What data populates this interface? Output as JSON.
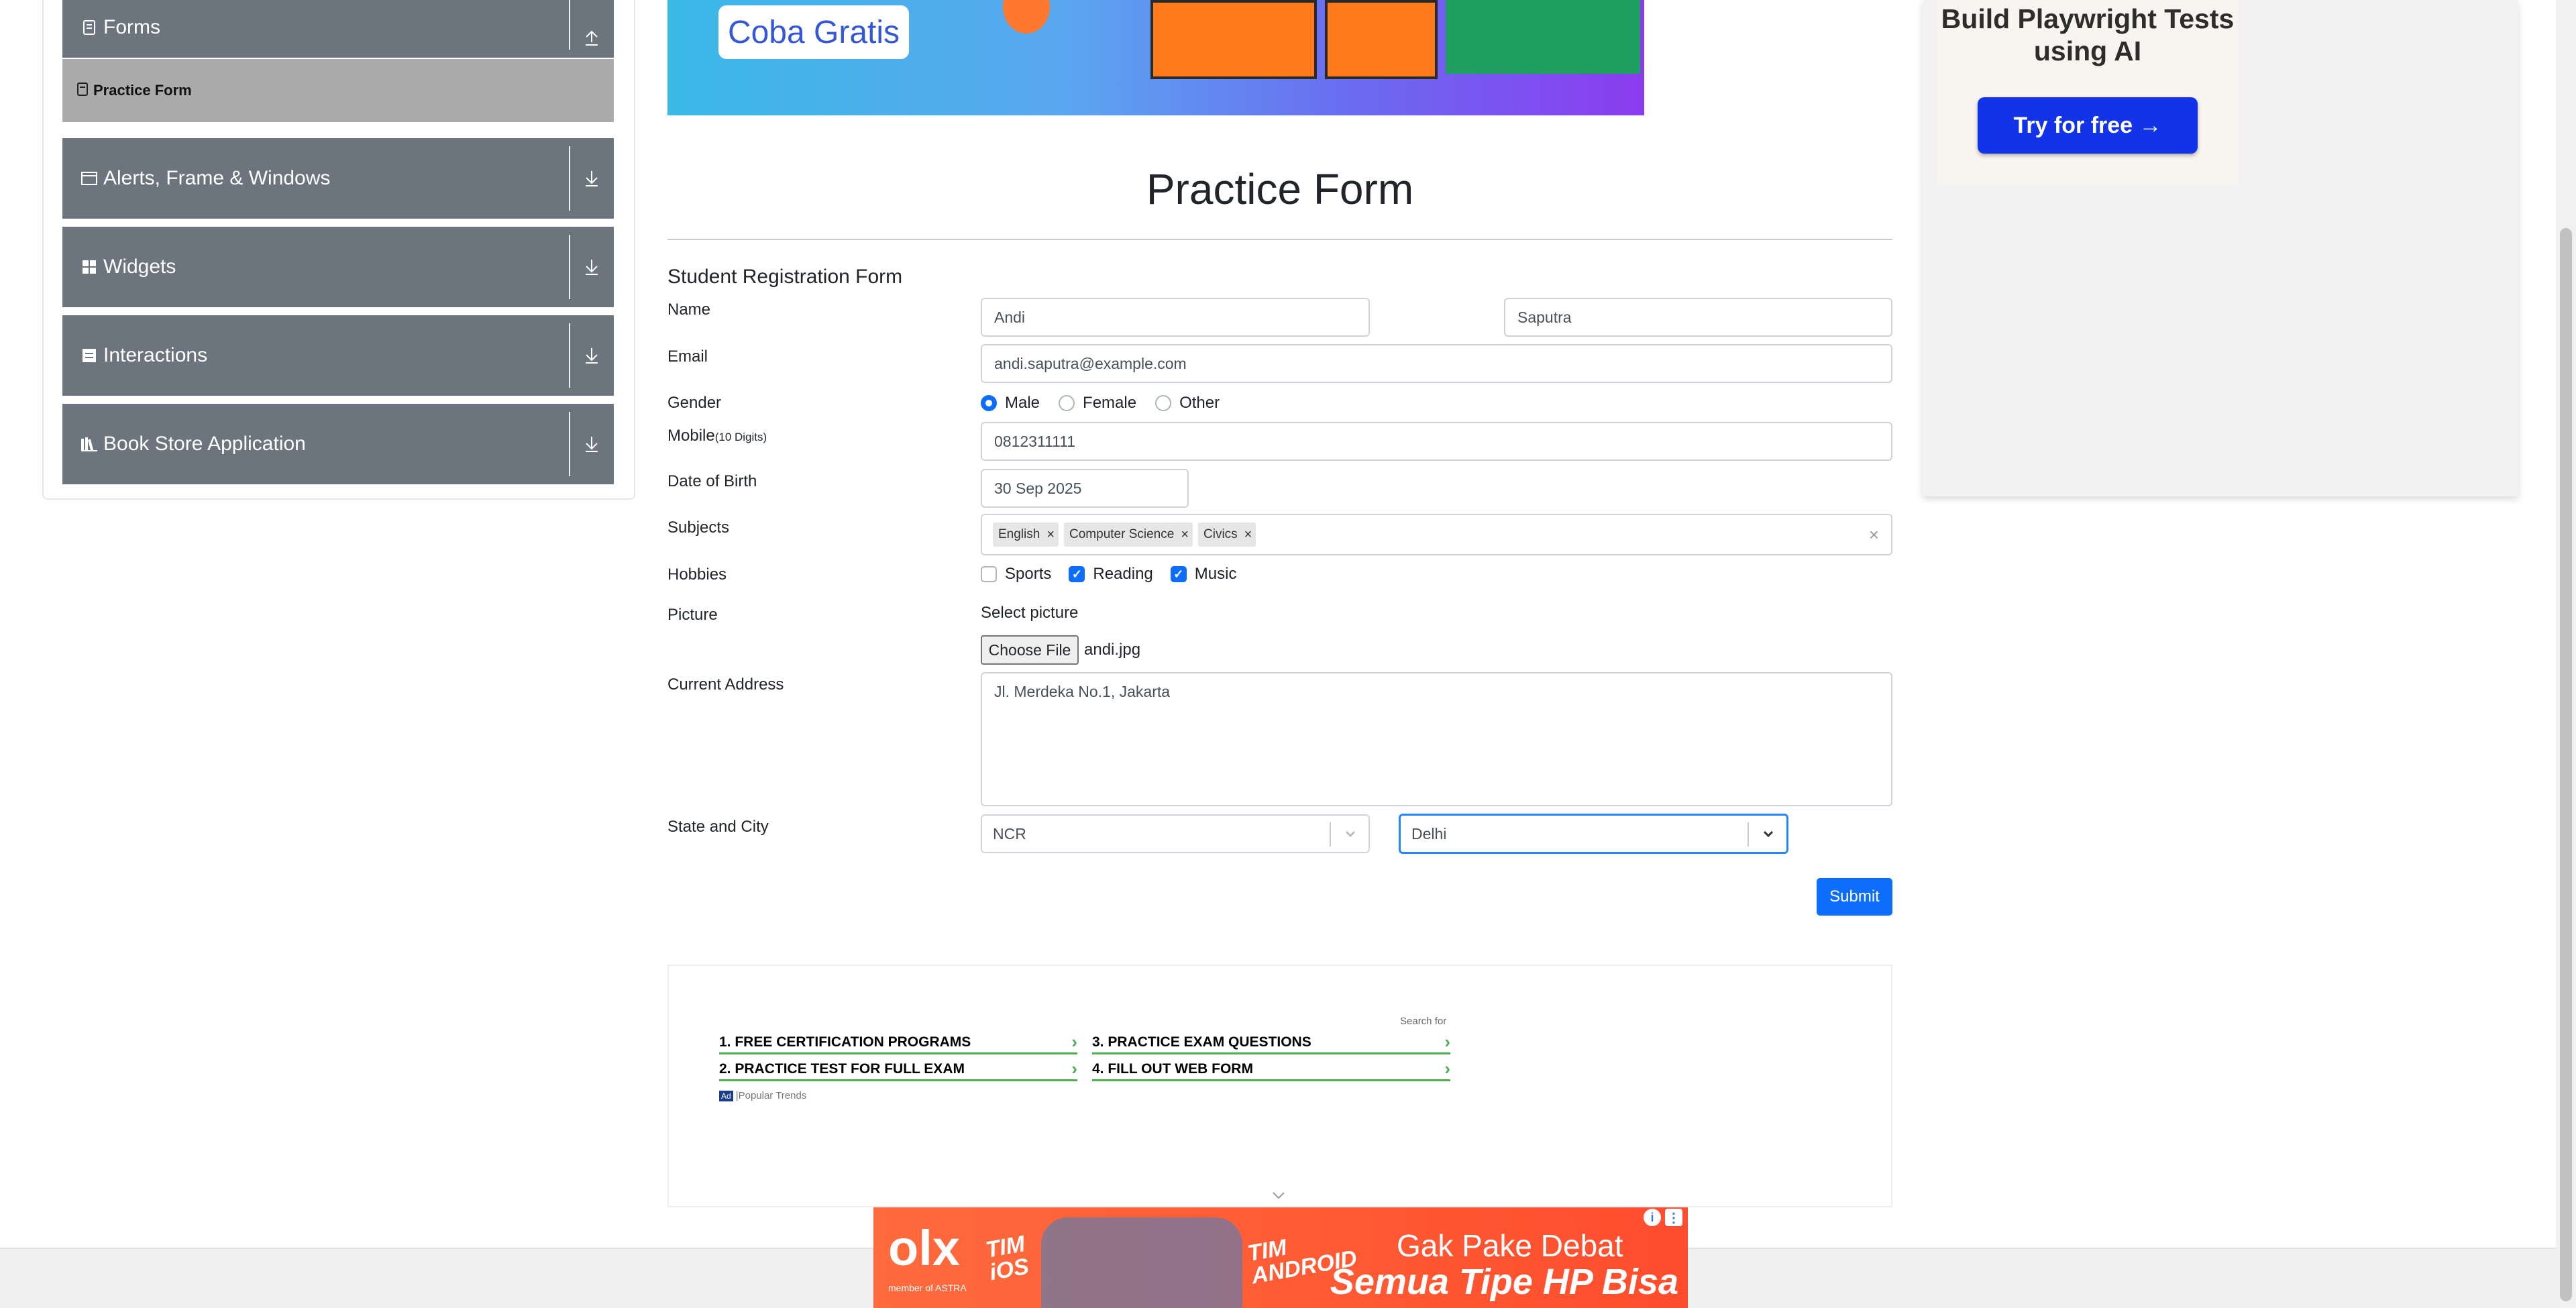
{
  "sidebar": {
    "forms_label": "Forms",
    "practice_form_label": "Practice Form",
    "groups": [
      {
        "label": "Alerts, Frame & Windows",
        "icon": "window-icon"
      },
      {
        "label": "Widgets",
        "icon": "grid-icon"
      },
      {
        "label": "Interactions",
        "icon": "list-icon"
      },
      {
        "label": "Book Store Application",
        "icon": "books-icon"
      }
    ]
  },
  "top_banner": {
    "cta": "Coba Gratis"
  },
  "right_ad": {
    "title": "Build Playwright Tests using AI",
    "button": "Try for free →"
  },
  "page": {
    "title": "Practice Form",
    "form_title": "Student Registration Form"
  },
  "form": {
    "name_label": "Name",
    "first_name": "Andi",
    "last_name": "Saputra",
    "email_label": "Email",
    "email": "andi.saputra@example.com",
    "gender_label": "Gender",
    "genders": [
      "Male",
      "Female",
      "Other"
    ],
    "gender_selected": "Male",
    "mobile_label": "Mobile",
    "mobile_hint": "(10 Digits)",
    "mobile": "0812311111",
    "dob_label": "Date of Birth",
    "dob": "30 Sep 2025",
    "subjects_label": "Subjects",
    "subjects": [
      "English",
      "Computer Science",
      "Civics"
    ],
    "subjects_clear": "×",
    "hobbies_label": "Hobbies",
    "hobbies": [
      {
        "label": "Sports",
        "checked": false
      },
      {
        "label": "Reading",
        "checked": true
      },
      {
        "label": "Music",
        "checked": true
      }
    ],
    "picture_label": "Picture",
    "select_picture": "Select picture",
    "choose_file": "Choose File",
    "file_name": "andi.jpg",
    "address_label": "Current Address",
    "address": "Jl. Merdeka No.1, Jakarta",
    "state_city_label": "State and City",
    "state": "NCR",
    "city": "Delhi",
    "submit": "Submit"
  },
  "bottom_ad": {
    "search_for": "Search for",
    "links": [
      {
        "num": "1.",
        "text": "FREE CERTIFICATION PROGRAMS"
      },
      {
        "num": "3.",
        "text": "PRACTICE EXAM QUESTIONS"
      },
      {
        "num": "2.",
        "text": "PRACTICE TEST FOR FULL EXAM"
      },
      {
        "num": "4.",
        "text": "FILL OUT WEB FORM"
      }
    ],
    "ad_badge": "Ad",
    "footer_text": "Popular Trends"
  },
  "olx_ad": {
    "logo": "olx",
    "logo_sub": "member of ASTRA",
    "tag1": "TIM iOS",
    "tag2": "TIM ANDROID",
    "headline": "Gak Pake Debat",
    "subhead": "Semua Tipe HP Bisa Didapat!"
  },
  "colors": {
    "sidebar": "#6c757d",
    "primary": "#0d6efd",
    "active": "#ababab"
  }
}
